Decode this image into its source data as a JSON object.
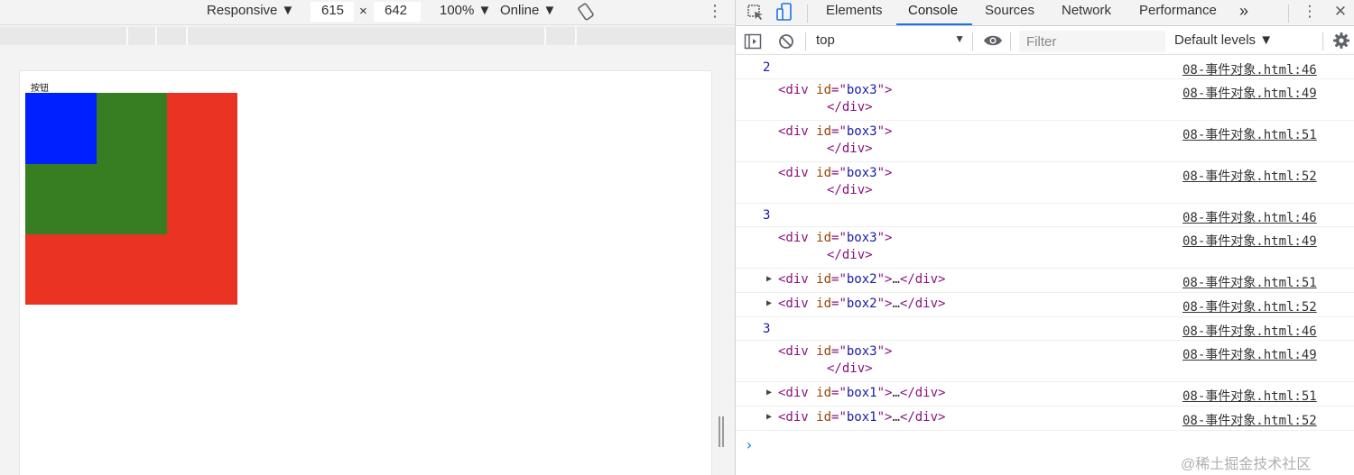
{
  "device_toolbar": {
    "dimensions_mode": "Responsive ▼",
    "width": "615",
    "times": "×",
    "height": "642",
    "zoom": "100% ▼",
    "throttle": "Online ▼",
    "more": "⋮"
  },
  "page": {
    "button_text": "按钮",
    "colors": {
      "box1": "#ea3323",
      "box2": "#377e22",
      "box3": "#0020ff"
    }
  },
  "devtools": {
    "tabs": [
      "Elements",
      "Console",
      "Sources",
      "Network",
      "Performance"
    ],
    "active_tab": "Console",
    "overflow": "»",
    "menu": "⋮",
    "close": "✕",
    "console_toolbar": {
      "context": "top",
      "context_chev": "▼",
      "filter_placeholder": "Filter",
      "levels": "Default levels ▼"
    }
  },
  "console": {
    "lines": [
      {
        "kind": "num",
        "text": "2",
        "src": "08-事件对象.html:46"
      },
      {
        "kind": "div",
        "id": "box3",
        "src": "08-事件对象.html:49"
      },
      {
        "kind": "div",
        "id": "box3",
        "src": "08-事件对象.html:51"
      },
      {
        "kind": "div",
        "id": "box3",
        "src": "08-事件对象.html:52"
      },
      {
        "kind": "num",
        "text": "3",
        "src": "08-事件对象.html:46"
      },
      {
        "kind": "div",
        "id": "box3",
        "src": "08-事件对象.html:49"
      },
      {
        "kind": "collapsed",
        "id": "box2",
        "src": "08-事件对象.html:51"
      },
      {
        "kind": "collapsed",
        "id": "box2",
        "src": "08-事件对象.html:52"
      },
      {
        "kind": "num",
        "text": "3",
        "src": "08-事件对象.html:46"
      },
      {
        "kind": "div",
        "id": "box3",
        "src": "08-事件对象.html:49"
      },
      {
        "kind": "collapsed",
        "id": "box1",
        "src": "08-事件对象.html:51"
      },
      {
        "kind": "collapsed",
        "id": "box1",
        "src": "08-事件对象.html:52"
      }
    ],
    "prompt": "›"
  },
  "watermark": "@稀土掘金技术社区"
}
